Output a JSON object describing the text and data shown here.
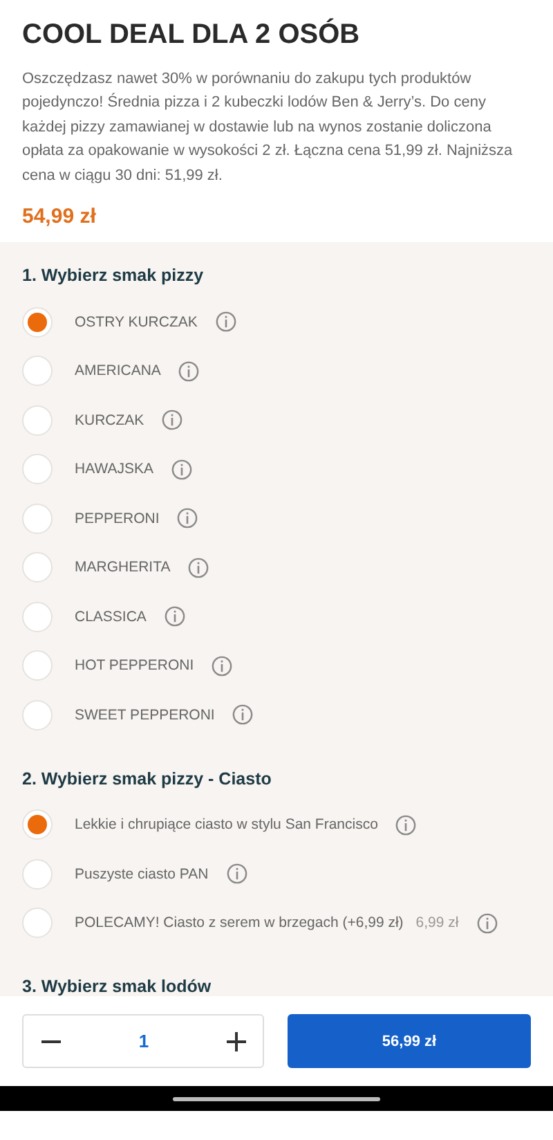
{
  "product": {
    "title": "COOL DEAL DLA 2 OSÓB",
    "description": "Oszczędzasz nawet 30% w porównaniu do zakupu tych produktów pojedynczo! Średnia pizza i 2 kubeczki lodów Ben & Jerry’s. Do ceny każdej pizzy zamawianej w dostawie lub na wynos zostanie doliczona opłata za opakowanie w wysokości 2 zł. Łączna cena 51,99 zł. Najniższa cena w ciągu 30 dni: 51,99 zł.",
    "price": "54,99 zł"
  },
  "sections": [
    {
      "heading": "1. Wybierz smak pizzy",
      "options": [
        {
          "label": "OSTRY KURCZAK",
          "selected": true
        },
        {
          "label": "AMERICANA",
          "selected": false
        },
        {
          "label": "KURCZAK",
          "selected": false
        },
        {
          "label": "HAWAJSKA",
          "selected": false
        },
        {
          "label": "PEPPERONI",
          "selected": false
        },
        {
          "label": "MARGHERITA",
          "selected": false
        },
        {
          "label": "CLASSICA",
          "selected": false
        },
        {
          "label": "HOT PEPPERONI",
          "selected": false
        },
        {
          "label": "SWEET PEPPERONI",
          "selected": false
        }
      ]
    },
    {
      "heading": "2. Wybierz smak pizzy - Ciasto",
      "options": [
        {
          "label": "Lekkie i chrupiące ciasto w stylu San Francisco",
          "selected": true
        },
        {
          "label": "Puszyste ciasto PAN",
          "selected": false
        },
        {
          "label": "POLECAMY! Ciasto z serem w brzegach (+6,99 zł)",
          "price": "6,99 zł",
          "selected": false
        }
      ]
    },
    {
      "heading": "3. Wybierz smak lodów"
    }
  ],
  "footer": {
    "quantity": "1",
    "add_button": "56,99 zł"
  }
}
